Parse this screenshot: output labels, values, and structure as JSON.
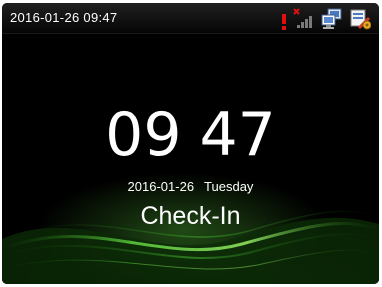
{
  "status_bar": {
    "datetime": "2016-01-26 09:47",
    "icons": [
      "alert-icon",
      "signal-icon",
      "network-icon",
      "tools-icon"
    ]
  },
  "clock": {
    "hours": "09",
    "minutes": "47"
  },
  "date": {
    "date": "2016-01-26",
    "weekday": "Tuesday"
  },
  "attendance_state": "Check-In",
  "colors": {
    "background": "#000000",
    "accent_green": "#5ac83c",
    "alert_red": "#e01010",
    "text": "#ffffff"
  }
}
